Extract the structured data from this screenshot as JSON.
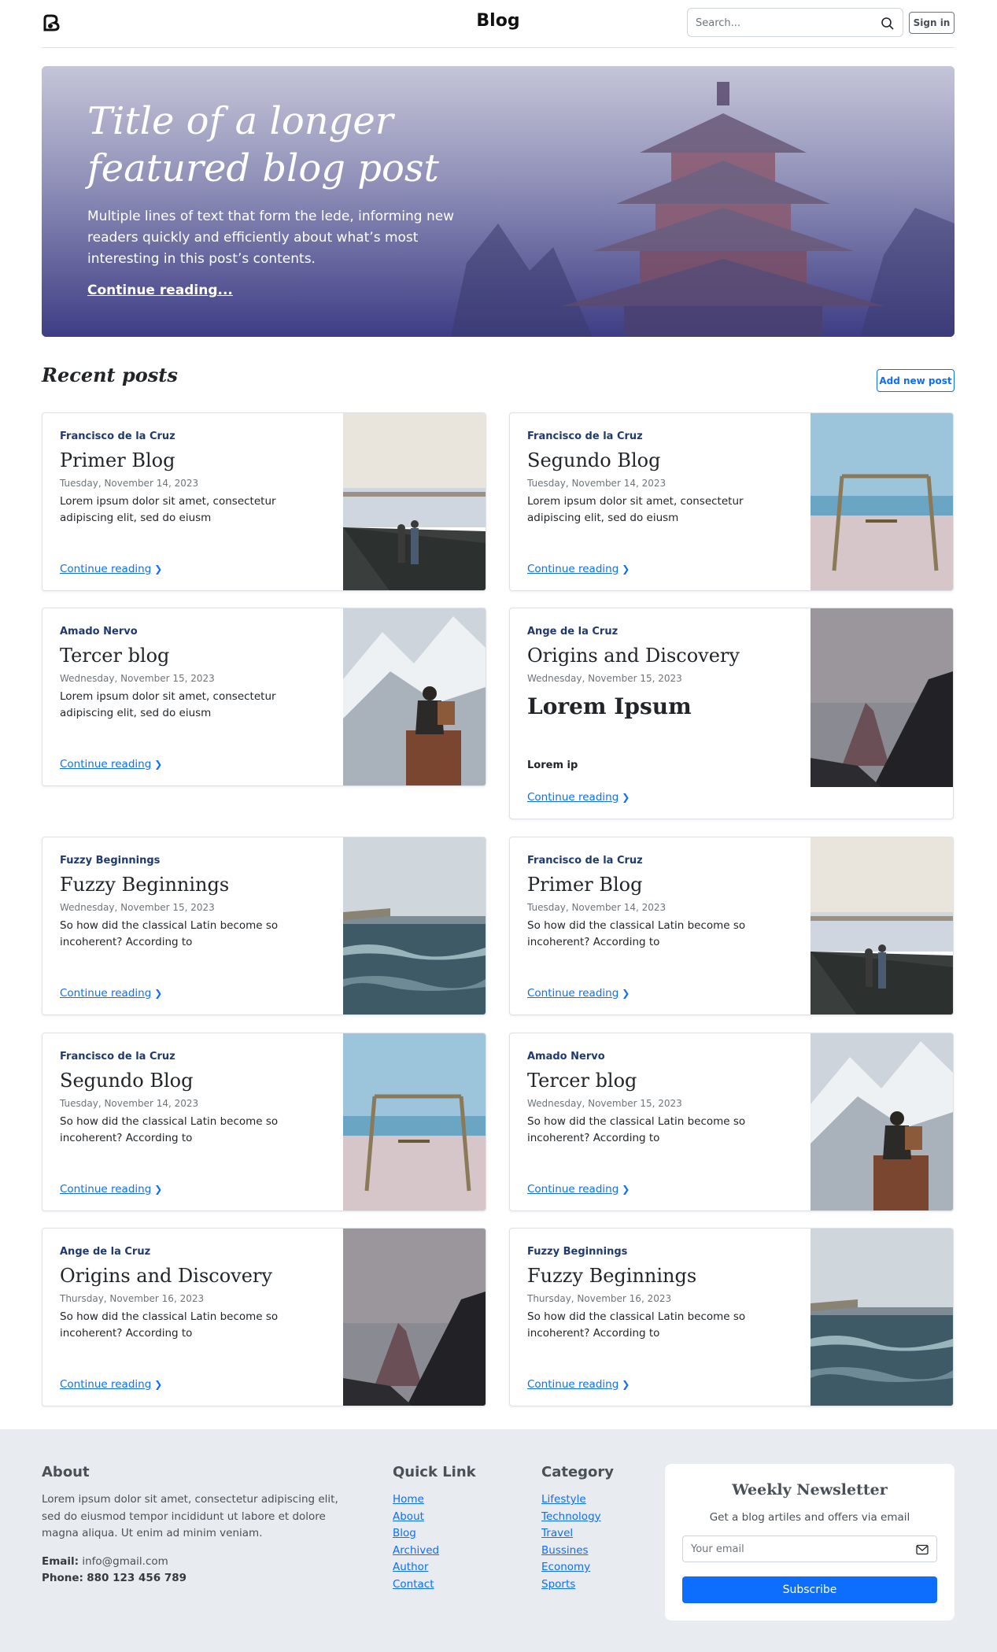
{
  "header": {
    "brand": "Blog",
    "search_placeholder": "Search...",
    "signin_label": "Sign in",
    "logo_icon": "bootstrap-logo-icon",
    "search_icon": "search-icon"
  },
  "hero": {
    "title": "Title of a longer featured blog post",
    "lede": "Multiple lines of text that form the lede, informing new readers quickly and efficiently about what’s most interesting in this post’s contents.",
    "link": "Continue reading..."
  },
  "recent": {
    "title": "Recent posts",
    "add_label": "Add new post"
  },
  "posts": [
    {
      "author": "Francisco de la Cruz",
      "title": "Primer Blog",
      "date": "Tuesday, November 14, 2023",
      "excerpt": "Lorem ipsum dolor sit amet, consectetur adipiscing elit, sed do eiusm",
      "link": "Continue reading",
      "image": "harbor"
    },
    {
      "author": "Francisco de la Cruz",
      "title": "Segundo Blog",
      "date": "Tuesday, November 14, 2023",
      "excerpt": "Lorem ipsum dolor sit amet, consectetur adipiscing elit, sed do eiusm",
      "link": "Continue reading",
      "image": "swing"
    },
    {
      "author": "Amado Nervo",
      "title": "Tercer blog",
      "date": "Wednesday, November 15, 2023",
      "excerpt": "Lorem ipsum dolor sit amet, consectetur adipiscing elit, sed do eiusm",
      "link": "Continue reading",
      "image": "mountain-hiker"
    },
    {
      "author": "Ange de la Cruz",
      "title": "Origins and Discovery",
      "date": "Wednesday, November 15, 2023",
      "big": "Lorem Ipsum",
      "small": "Lorem ip",
      "link": "Continue reading",
      "image": "peak"
    },
    {
      "author": "Fuzzy Beginnings",
      "title": "Fuzzy Beginnings",
      "date": "Wednesday, November 15, 2023",
      "excerpt": "So how did the classical Latin become so incoherent? According to",
      "link": "Continue reading",
      "image": "sea"
    },
    {
      "author": "Francisco de la Cruz",
      "title": "Primer Blog",
      "date": "Tuesday, November 14, 2023",
      "excerpt": "So how did the classical Latin become so incoherent? According to",
      "link": "Continue reading",
      "image": "harbor"
    },
    {
      "author": "Francisco de la Cruz",
      "title": "Segundo Blog",
      "date": "Tuesday, November 14, 2023",
      "excerpt": "So how did the classical Latin become so incoherent? According to",
      "link": "Continue reading",
      "image": "swing"
    },
    {
      "author": "Amado Nervo",
      "title": "Tercer blog",
      "date": "Wednesday, November 15, 2023",
      "excerpt": "So how did the classical Latin become so incoherent? According to",
      "link": "Continue reading",
      "image": "mountain-hiker"
    },
    {
      "author": "Ange de la Cruz",
      "title": "Origins and Discovery",
      "date": "Thursday, November 16, 2023",
      "excerpt": "So how did the classical Latin become so incoherent? According to",
      "link": "Continue reading",
      "image": "peak"
    },
    {
      "author": "Fuzzy Beginnings",
      "title": "Fuzzy Beginnings",
      "date": "Thursday, November 16, 2023",
      "excerpt": "So how did the classical Latin become so incoherent? According to",
      "link": "Continue reading",
      "image": "sea"
    }
  ],
  "footer": {
    "about_title": "About",
    "about_text": "Lorem ipsum dolor sit amet, consectetur adipiscing elit, sed do eiusmod tempor incididunt ut labore et dolore magna aliqua. Ut enim ad minim veniam.",
    "email_label": "Email:",
    "email_value": "info@gmail.com",
    "phone_label": "Phone:",
    "phone_value": "880 123 456 789",
    "quick_title": "Quick Link",
    "quick_links": [
      "Home",
      "About",
      "Blog",
      "Archived",
      "Author",
      "Contact"
    ],
    "category_title": "Category",
    "categories": [
      "Lifestyle",
      "Technology",
      "Travel",
      "Bussines",
      "Economy",
      "Sports"
    ],
    "newsletter_title": "Weekly Newsletter",
    "newsletter_sub": "Get a blog artiles and offers via email",
    "newsletter_placeholder": "Your email",
    "subscribe_label": "Subscribe",
    "mail_icon": "envelope-icon"
  },
  "colors": {
    "accent": "#0d6efd",
    "author": "#1e3a6e",
    "footer_bg": "#e8ebef",
    "hero_tint": "#3f3f86"
  }
}
